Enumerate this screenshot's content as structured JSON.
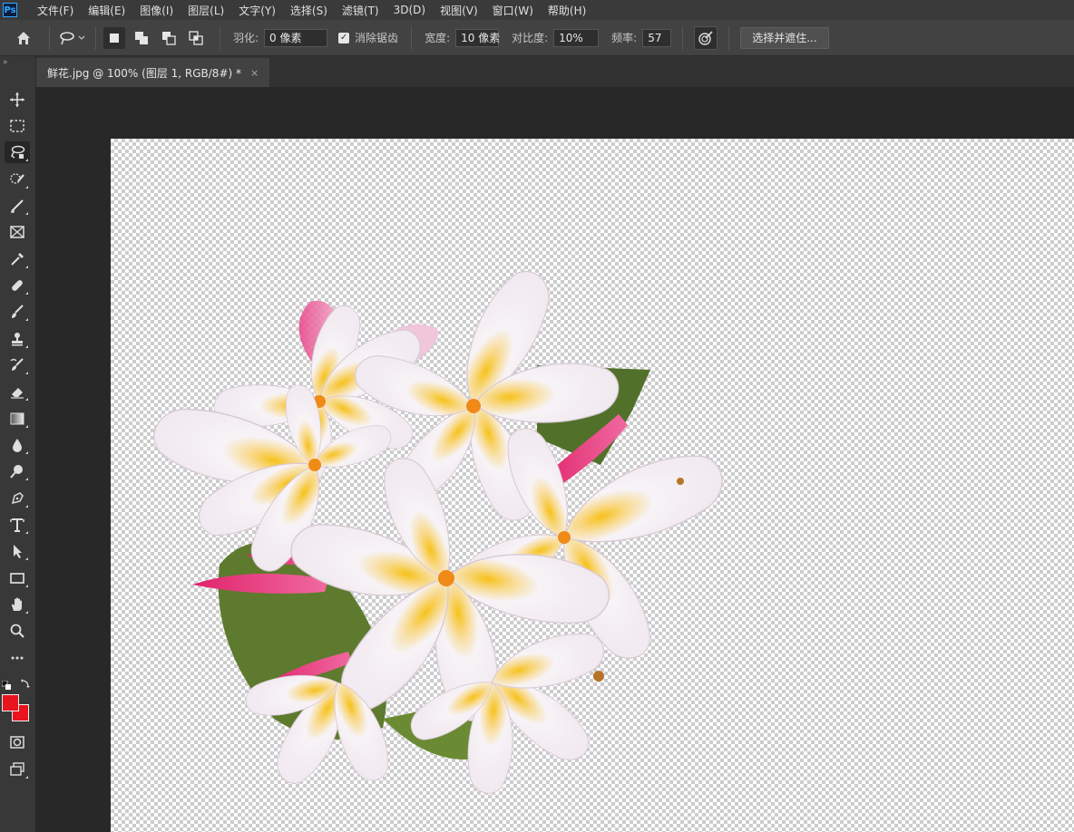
{
  "app": {
    "logo_text": "Ps"
  },
  "menu": [
    {
      "id": "file",
      "label": "文件(F)"
    },
    {
      "id": "edit",
      "label": "编辑(E)"
    },
    {
      "id": "image",
      "label": "图像(I)"
    },
    {
      "id": "layer",
      "label": "图层(L)"
    },
    {
      "id": "type",
      "label": "文字(Y)"
    },
    {
      "id": "select",
      "label": "选择(S)"
    },
    {
      "id": "filter",
      "label": "滤镜(T)"
    },
    {
      "id": "3d",
      "label": "3D(D)"
    },
    {
      "id": "view",
      "label": "视图(V)"
    },
    {
      "id": "window",
      "label": "窗口(W)"
    },
    {
      "id": "help",
      "label": "帮助(H)"
    }
  ],
  "options": {
    "feather_label": "羽化:",
    "feather_value": "0 像素",
    "antialias_label": "消除锯齿",
    "antialias_checked": true,
    "width_label": "宽度:",
    "width_value": "10 像素",
    "contrast_label": "对比度:",
    "contrast_value": "10%",
    "frequency_label": "频率:",
    "frequency_value": "57",
    "select_mask_label": "选择并遮住..."
  },
  "document_tab": {
    "title": "鲜花.jpg @ 100% (图层 1, RGB/8#) *",
    "close": "×"
  },
  "tools_panel": {
    "collapse": "»",
    "active_tool": "magnetic-lasso-tool",
    "foreground_color": "#e8141e",
    "background_color": "#e8141e"
  },
  "colors": {
    "accent_blue": "#31a8ff",
    "panel": "#424242"
  }
}
